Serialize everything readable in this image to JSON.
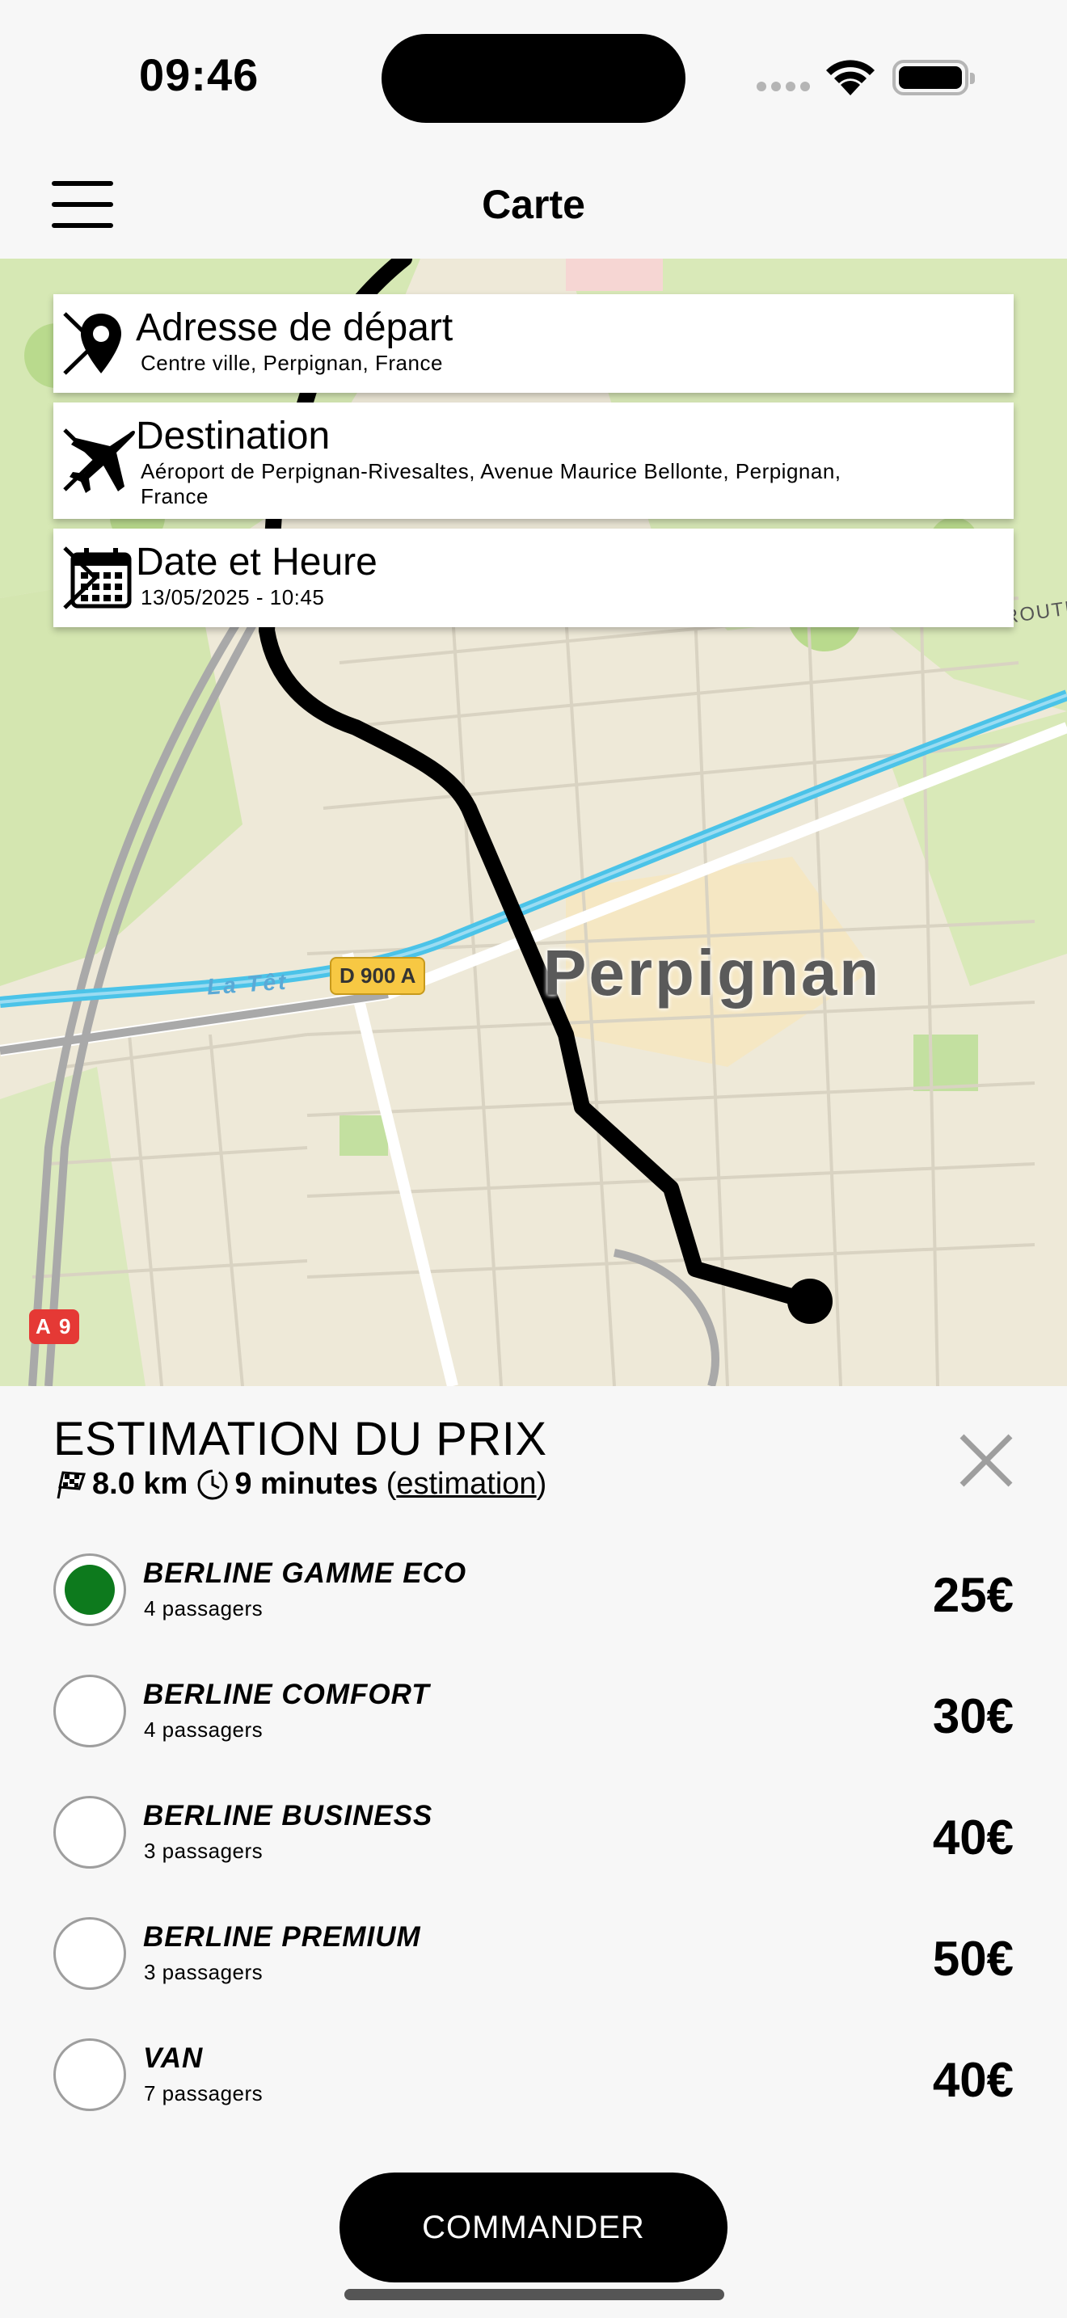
{
  "status_bar": {
    "time": "09:46"
  },
  "nav": {
    "title": "Carte",
    "menu_icon": "hamburger-icon"
  },
  "map": {
    "city_label": "Perpignan",
    "river_label": "La Têt",
    "road_label_d900a": "D 900 A",
    "road_label_a9": "A 9",
    "road_label_partial": "ROUTE",
    "route_color": "#000000"
  },
  "cards": {
    "departure": {
      "icon": "map-pin-icon",
      "title": "Adresse de départ",
      "subtitle": "Centre ville, Perpignan, France"
    },
    "destination": {
      "icon": "airplane-icon",
      "title": "Destination",
      "subtitle": "Aéroport de Perpignan-Rivesaltes, Avenue Maurice Bellonte, Perpignan, France"
    },
    "datetime": {
      "icon": "calendar-icon",
      "title": "Date et Heure",
      "subtitle": "13/05/2025 - 10:45"
    }
  },
  "estimate": {
    "title": "ESTIMATION DU PRIX",
    "distance": "8.0 km",
    "duration": "9 minutes",
    "estimation_link": "estimation",
    "paren_open": "(",
    "paren_close": ")"
  },
  "vehicles": [
    {
      "name": "BERLINE GAMME ECO",
      "passengers": "4 passagers",
      "price": "25€",
      "selected": true
    },
    {
      "name": "BERLINE COMFORT",
      "passengers": "4 passagers",
      "price": "30€",
      "selected": false
    },
    {
      "name": "BERLINE BUSINESS",
      "passengers": "3 passagers",
      "price": "40€",
      "selected": false
    },
    {
      "name": "BERLINE PREMIUM",
      "passengers": "3 passagers",
      "price": "50€",
      "selected": false
    },
    {
      "name": "VAN",
      "passengers": "7 passagers",
      "price": "40€",
      "selected": false
    }
  ],
  "order_button": {
    "label": "COMMANDER"
  },
  "colors": {
    "selected_radio": "#0d7a1d",
    "accent": "#000000",
    "background": "#f7f7f7"
  }
}
